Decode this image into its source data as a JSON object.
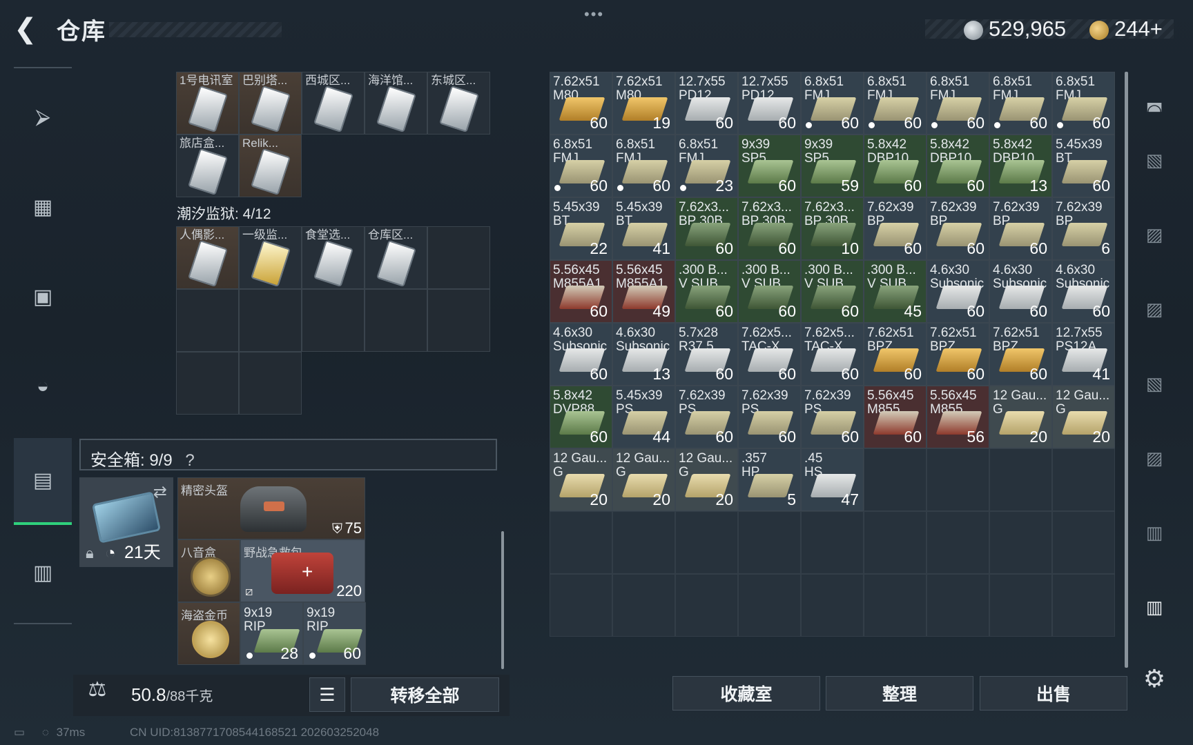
{
  "header": {
    "title": "仓库",
    "back_icon": "back-arrow-icon",
    "silver": "529,965",
    "gold": "244+"
  },
  "sidebar": {
    "items": [
      "gun-icon",
      "armor-vest-icon",
      "backpack-icon",
      "rig-icon",
      "safe-case-icon",
      "toolbox-icon"
    ],
    "active": 4
  },
  "container1": {
    "row1": [
      "1号电讯室",
      "巴别塔...",
      "西城区...",
      "海洋馆...",
      "东城区..."
    ],
    "row2": [
      "旅店盒...",
      "Relik..."
    ]
  },
  "container2": {
    "label": "潮汐监狱: 4/12",
    "items": [
      "人偶影...",
      "一级监...",
      "食堂选...",
      "仓库区..."
    ]
  },
  "safe": {
    "label": "安全箱: 9/9",
    "help": "?",
    "days": "21天",
    "items": {
      "helmet": "精密头盔",
      "helmet_val": "75",
      "compass": "八音盒",
      "medkit": "野战急救包",
      "medkit_val": "220",
      "coin": "海盗金币",
      "ammo1": "9x19",
      "ammo1b": "RIP",
      "ammo1c": "28",
      "ammo2": "9x19",
      "ammo2b": "RIP",
      "ammo2c": "60"
    }
  },
  "weight": {
    "value": "50.8",
    "max": "/88千克"
  },
  "buttons": {
    "transfer_all": "转移全部",
    "collection": "收藏室",
    "organize": "整理",
    "sell": "出售"
  },
  "ammo_grid": [
    {
      "n1": "7.62x51",
      "n2": "M80",
      "c": "60",
      "box": "gold",
      "bg": ""
    },
    {
      "n1": "7.62x51",
      "n2": "M80",
      "c": "19",
      "box": "gold",
      "bg": ""
    },
    {
      "n1": "12.7x55",
      "n2": "PD12",
      "c": "60",
      "box": "grey",
      "bg": ""
    },
    {
      "n1": "12.7x55",
      "n2": "PD12",
      "c": "60",
      "box": "grey",
      "bg": ""
    },
    {
      "n1": "6.8x51",
      "n2": "FMJ",
      "c": "60",
      "box": "khaki",
      "bg": "",
      "dot": true
    },
    {
      "n1": "6.8x51",
      "n2": "FMJ",
      "c": "60",
      "box": "khaki",
      "bg": "",
      "dot": true
    },
    {
      "n1": "6.8x51",
      "n2": "FMJ",
      "c": "60",
      "box": "khaki",
      "bg": "",
      "dot": true
    },
    {
      "n1": "6.8x51",
      "n2": "FMJ",
      "c": "60",
      "box": "khaki",
      "bg": "",
      "dot": true
    },
    {
      "n1": "6.8x51",
      "n2": "FMJ",
      "c": "60",
      "box": "khaki",
      "bg": "",
      "dot": true
    },
    {
      "n1": "6.8x51",
      "n2": "FMJ",
      "c": "60",
      "box": "khaki",
      "bg": "",
      "dot": true
    },
    {
      "n1": "6.8x51",
      "n2": "FMJ",
      "c": "60",
      "box": "khaki",
      "bg": "",
      "dot": true
    },
    {
      "n1": "6.8x51",
      "n2": "FMJ",
      "c": "23",
      "box": "khaki",
      "bg": "",
      "dot": true
    },
    {
      "n1": "9x39",
      "n2": "SP5",
      "c": "60",
      "box": "green",
      "bg": "bg-green"
    },
    {
      "n1": "9x39",
      "n2": "SP5",
      "c": "59",
      "box": "green",
      "bg": "bg-green"
    },
    {
      "n1": "5.8x42",
      "n2": "DBP10",
      "c": "60",
      "box": "green",
      "bg": "bg-green"
    },
    {
      "n1": "5.8x42",
      "n2": "DBP10",
      "c": "60",
      "box": "green",
      "bg": "bg-green"
    },
    {
      "n1": "5.8x42",
      "n2": "DBP10",
      "c": "13",
      "box": "green",
      "bg": "bg-green"
    },
    {
      "n1": "5.45x39",
      "n2": "BT",
      "c": "60",
      "box": "khaki",
      "bg": ""
    },
    {
      "n1": "5.45x39",
      "n2": "BT",
      "c": "22",
      "box": "khaki",
      "bg": ""
    },
    {
      "n1": "5.45x39",
      "n2": "BT",
      "c": "41",
      "box": "khaki",
      "bg": ""
    },
    {
      "n1": "7.62x3...",
      "n2": "BP 30B",
      "c": "60",
      "box": "dark",
      "bg": "bg-green"
    },
    {
      "n1": "7.62x3...",
      "n2": "BP 30B",
      "c": "60",
      "box": "dark",
      "bg": "bg-green"
    },
    {
      "n1": "7.62x3...",
      "n2": "BP 30B",
      "c": "10",
      "box": "dark",
      "bg": "bg-green"
    },
    {
      "n1": "7.62x39",
      "n2": "BP",
      "c": "60",
      "box": "khaki",
      "bg": ""
    },
    {
      "n1": "7.62x39",
      "n2": "BP",
      "c": "60",
      "box": "khaki",
      "bg": ""
    },
    {
      "n1": "7.62x39",
      "n2": "BP",
      "c": "60",
      "box": "khaki",
      "bg": ""
    },
    {
      "n1": "7.62x39",
      "n2": "BP",
      "c": "6",
      "box": "khaki",
      "bg": ""
    },
    {
      "n1": "5.56x45",
      "n2": "M855A1",
      "c": "60",
      "box": "red",
      "bg": "bg-red"
    },
    {
      "n1": "5.56x45",
      "n2": "M855A1",
      "c": "49",
      "box": "red",
      "bg": "bg-red"
    },
    {
      "n1": ".300 B...",
      "n2": "V SUB",
      "c": "60",
      "box": "dark",
      "bg": "bg-green"
    },
    {
      "n1": ".300 B...",
      "n2": "V SUB",
      "c": "60",
      "box": "dark",
      "bg": "bg-green"
    },
    {
      "n1": ".300 B...",
      "n2": "V SUB",
      "c": "60",
      "box": "dark",
      "bg": "bg-green"
    },
    {
      "n1": ".300 B...",
      "n2": "V SUB",
      "c": "45",
      "box": "dark",
      "bg": "bg-green"
    },
    {
      "n1": "4.6x30",
      "n2": "Subsonic",
      "c": "60",
      "box": "grey",
      "bg": ""
    },
    {
      "n1": "4.6x30",
      "n2": "Subsonic",
      "c": "60",
      "box": "grey",
      "bg": ""
    },
    {
      "n1": "4.6x30",
      "n2": "Subsonic",
      "c": "60",
      "box": "grey",
      "bg": ""
    },
    {
      "n1": "4.6x30",
      "n2": "Subsonic",
      "c": "60",
      "box": "grey",
      "bg": ""
    },
    {
      "n1": "4.6x30",
      "n2": "Subsonic",
      "c": "13",
      "box": "grey",
      "bg": ""
    },
    {
      "n1": "5.7x28",
      "n2": "R37.5",
      "c": "60",
      "box": "grey",
      "bg": ""
    },
    {
      "n1": "7.62x5...",
      "n2": "TAC-X",
      "c": "60",
      "box": "grey",
      "bg": ""
    },
    {
      "n1": "7.62x5...",
      "n2": "TAC-X",
      "c": "60",
      "box": "grey",
      "bg": ""
    },
    {
      "n1": "7.62x51",
      "n2": "BPZ",
      "c": "60",
      "box": "gold",
      "bg": ""
    },
    {
      "n1": "7.62x51",
      "n2": "BPZ",
      "c": "60",
      "box": "gold",
      "bg": ""
    },
    {
      "n1": "7.62x51",
      "n2": "BPZ",
      "c": "60",
      "box": "gold",
      "bg": ""
    },
    {
      "n1": "12.7x55",
      "n2": "PS12A",
      "c": "41",
      "box": "grey",
      "bg": ""
    },
    {
      "n1": "5.8x42",
      "n2": "DVP88",
      "c": "60",
      "box": "green",
      "bg": "bg-green"
    },
    {
      "n1": "5.45x39",
      "n2": "PS",
      "c": "44",
      "box": "khaki",
      "bg": ""
    },
    {
      "n1": "7.62x39",
      "n2": "PS",
      "c": "60",
      "box": "khaki",
      "bg": ""
    },
    {
      "n1": "7.62x39",
      "n2": "PS",
      "c": "60",
      "box": "khaki",
      "bg": ""
    },
    {
      "n1": "7.62x39",
      "n2": "PS",
      "c": "60",
      "box": "khaki",
      "bg": ""
    },
    {
      "n1": "5.56x45",
      "n2": "M855",
      "c": "60",
      "box": "red",
      "bg": "bg-red"
    },
    {
      "n1": "5.56x45",
      "n2": "M855",
      "c": "56",
      "box": "red",
      "bg": "bg-red"
    },
    {
      "n1": "12 Gau...",
      "n2": "G",
      "c": "20",
      "box": "tan",
      "bg": "bg-tan"
    },
    {
      "n1": "12 Gau...",
      "n2": "G",
      "c": "20",
      "box": "tan",
      "bg": "bg-tan"
    },
    {
      "n1": "12 Gau...",
      "n2": "G",
      "c": "20",
      "box": "tan",
      "bg": "bg-tan"
    },
    {
      "n1": "12 Gau...",
      "n2": "G",
      "c": "20",
      "box": "tan",
      "bg": "bg-tan"
    },
    {
      "n1": "12 Gau...",
      "n2": "G",
      "c": "20",
      "box": "tan",
      "bg": "bg-tan"
    },
    {
      "n1": ".357",
      "n2": "HP",
      "c": "5",
      "box": "khaki",
      "bg": ""
    },
    {
      "n1": ".45",
      "n2": "HS",
      "c": "47",
      "box": "grey",
      "bg": ""
    }
  ],
  "right_tools": [
    "helmet-icon",
    "armor-icon",
    "armor-iv-icon",
    "armor-iv-icon",
    "armor-icon",
    "armor-iv-icon",
    "folder-iv-icon",
    "folder-iv-active-icon",
    "settings-gear-icon"
  ],
  "status": {
    "ping": "37ms",
    "uid": "CN UID:8138771708544168521 202603252048"
  }
}
